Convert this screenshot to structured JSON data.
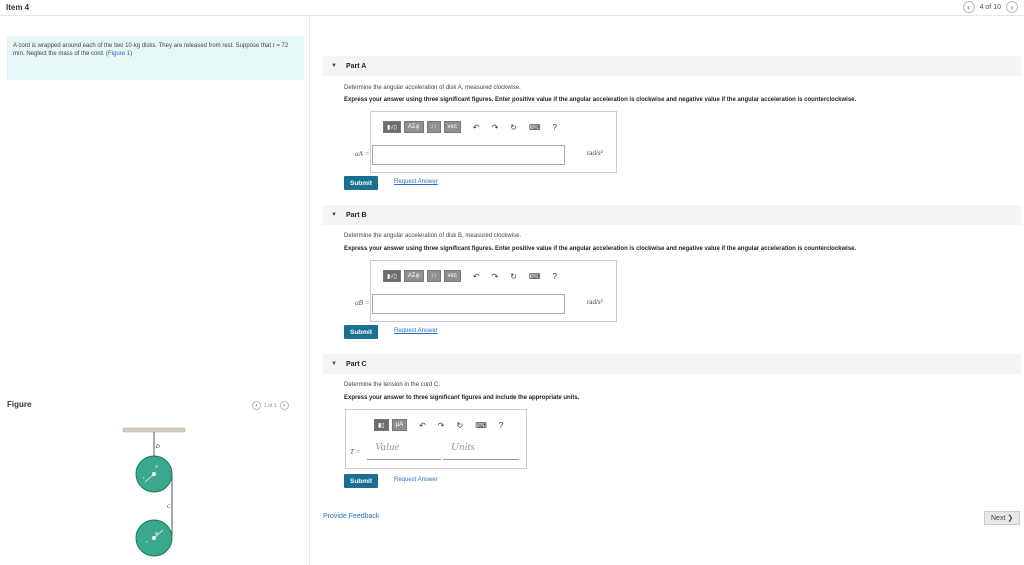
{
  "header": {
    "item_title": "Item 4",
    "pager_text": "4 of 10",
    "prev_icon": "chevron-left-icon",
    "next_icon": "chevron-right-icon"
  },
  "problem": {
    "text_1": "A cord is wrapped around each of the two 10-kg disks. They are released from rest. Suppose that r = 72 mm. Neglect the mass of the cord. (",
    "figure_link": "Figure 1",
    "text_2": ")"
  },
  "figure": {
    "label": "Figure",
    "pager_text": "1 of 1",
    "point_d": "D",
    "point_c": "C",
    "label_a": "A",
    "label_b": "B",
    "label_r1": "r",
    "label_r2": "r"
  },
  "parts": [
    {
      "title": "Part A",
      "question": "Determine the angular acceleration of disk A, measured clockwise.",
      "instruction": "Express your answer using three significant figures. Enter positive value if the angular acceleration is clockwise and negative value if the angular acceleration is counterclockwise.",
      "toolbar": [
        "▮√▯",
        "ΑΣφ",
        "↓↑",
        "vec",
        "↶",
        "↷",
        "↻",
        "⌨",
        "?"
      ],
      "eq_label": "αA =",
      "unit": "rad/s²",
      "submit": "Submit",
      "request": "Request Answer"
    },
    {
      "title": "Part B",
      "question": "Determine the angular acceleration of disk B, measured clockwise.",
      "instruction": "Express your answer using three significant figures. Enter positive value if the angular acceleration is clockwise and negative value if the angular acceleration is counterclockwise.",
      "toolbar": [
        "▮√▯",
        "ΑΣφ",
        "↓↑",
        "vec",
        "↶",
        "↷",
        "↻",
        "⌨",
        "?"
      ],
      "eq_label": "αB =",
      "unit": "rad/s²",
      "submit": "Submit",
      "request": "Request Answer"
    },
    {
      "title": "Part C",
      "question": "Determine the tension in the cord C.",
      "instruction": "Express your answer to three significant figures and include the appropriate units.",
      "toolbar": [
        "▮▯",
        "μA",
        "↶",
        "↷",
        "↻",
        "⌨",
        "?"
      ],
      "eq_label": "T =",
      "value_placeholder": "Value",
      "units_placeholder": "Units",
      "submit": "Submit",
      "request": "Request Answer"
    }
  ],
  "footer": {
    "feedback": "Provide Feedback",
    "next": "Next ❯"
  },
  "colors": {
    "submit": "#1a7090",
    "link": "#2a70c0",
    "problem_bg": "#e7f6f6",
    "disk": "#2e9e82"
  }
}
